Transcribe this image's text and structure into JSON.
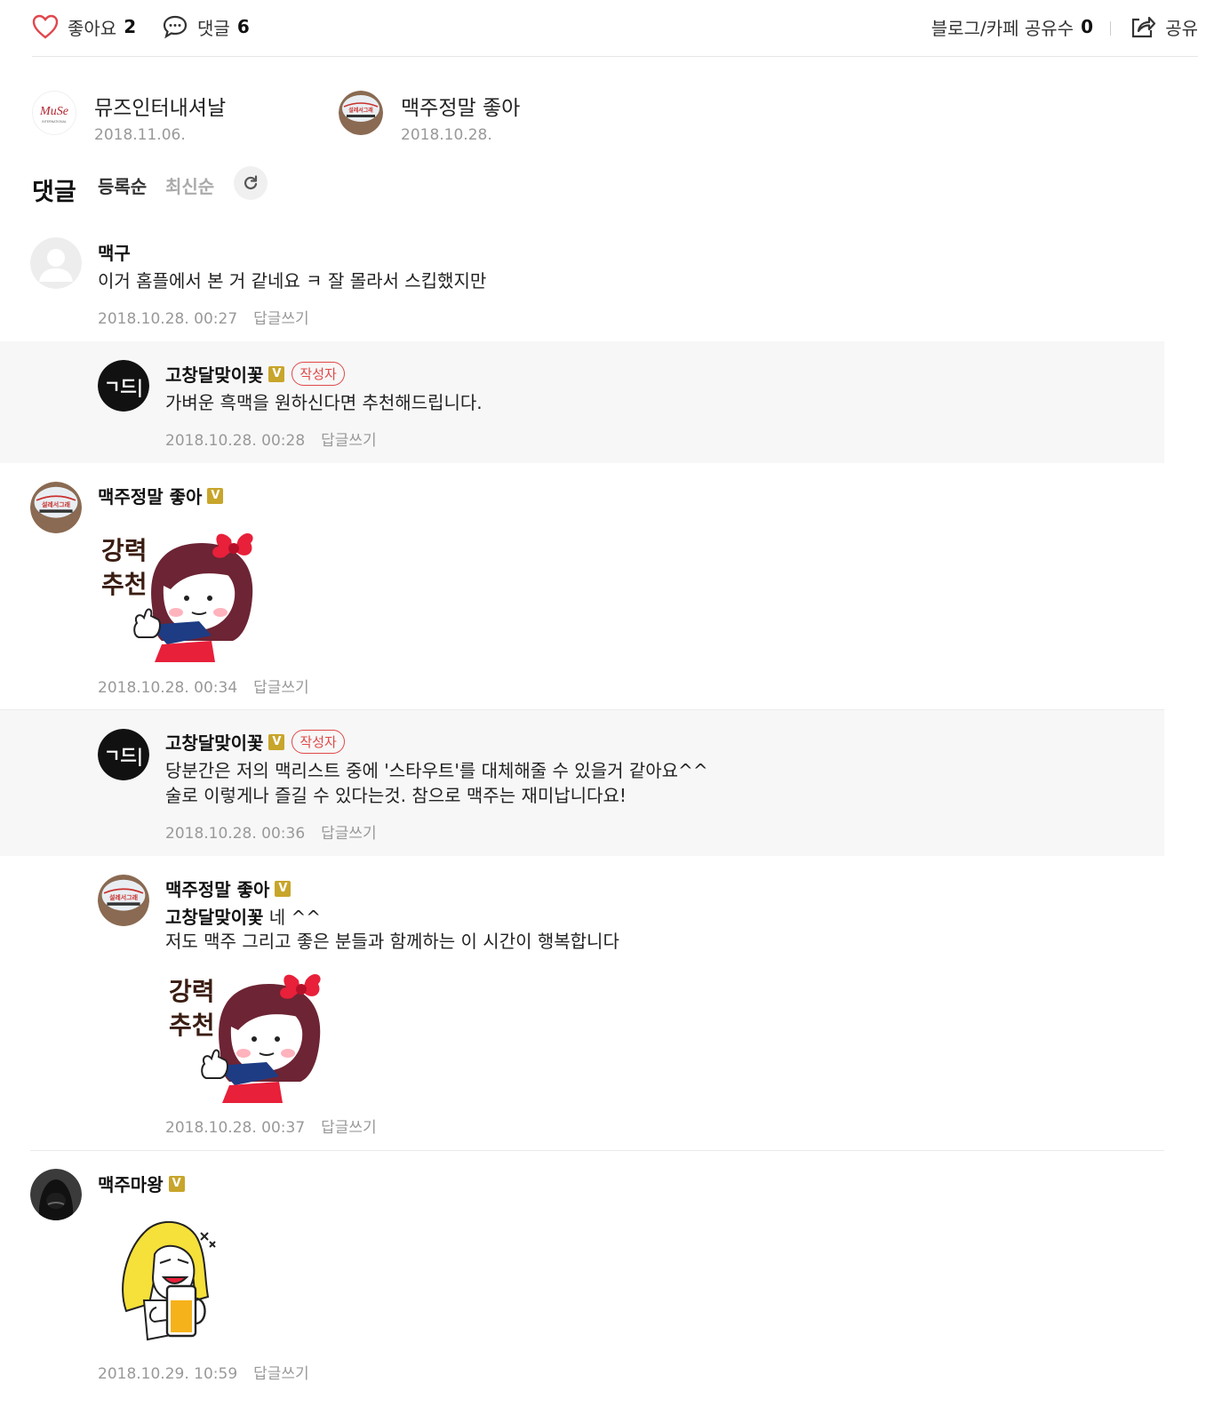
{
  "topbar": {
    "like_label": "좋아요",
    "like_count": "2",
    "comment_label": "댓글",
    "comment_count": "6",
    "share_count_label": "블로그/카페 공유수",
    "share_count": "0",
    "share_label": "공유"
  },
  "likers": [
    {
      "name": "뮤즈인터내셔날",
      "date": "2018.11.06.",
      "avatar_text": "MuSe",
      "avatar_sub": "INTERNATIONAL"
    },
    {
      "name": "맥주정말 좋아",
      "date": "2018.10.28."
    }
  ],
  "comments_header": {
    "title": "댓글",
    "sort_registered": "등록순",
    "sort_latest": "최신순"
  },
  "comments": [
    {
      "author": "맥구",
      "text": "이거 홈플에서 본 거 같네요 ㅋ 잘 몰라서 스킵했지만",
      "time": "2018.10.28. 00:27",
      "reply": "답글쓰기"
    },
    {
      "author": "고창달맞이꽃",
      "badge": "작성자",
      "text": "가벼운 흑맥을 원하신다면 추천해드립니다.",
      "time": "2018.10.28. 00:28",
      "reply": "답글쓰기"
    },
    {
      "author": "맥주정말 좋아",
      "sticker_text": [
        "강력",
        "추천"
      ],
      "time": "2018.10.28. 00:34",
      "reply": "답글쓰기"
    },
    {
      "author": "고창달맞이꽃",
      "badge": "작성자",
      "text_line1": "당분간은 저의 맥리스트 중에 '스타우트'를 대체해줄 수 있을거 같아요^^",
      "text_line2": "술로 이렇게나 즐길 수 있다는것. 참으로 맥주는 재미납니다요!",
      "time": "2018.10.28. 00:36",
      "reply": "답글쓰기"
    },
    {
      "author": "맥주정말 좋아",
      "mention": "고창달맞이꽃",
      "text_line1": "네 ^^",
      "text_line2": "저도 맥주 그리고 좋은 분들과 함께하는 이 시간이 행복합니다",
      "sticker_text": [
        "강력",
        "추천"
      ],
      "time": "2018.10.28. 00:37",
      "reply": "답글쓰기"
    },
    {
      "author": "맥주마왕",
      "time": "2018.10.29. 10:59",
      "reply": "답글쓰기"
    }
  ],
  "badge_verified": "V",
  "avatar_gochang_text": "ㄱ드|",
  "beer_avatar_text": "설레서그래",
  "colors": {
    "heart": "#e0474c",
    "badge_gold": "#c8a52b",
    "writer_red": "#e04848"
  }
}
